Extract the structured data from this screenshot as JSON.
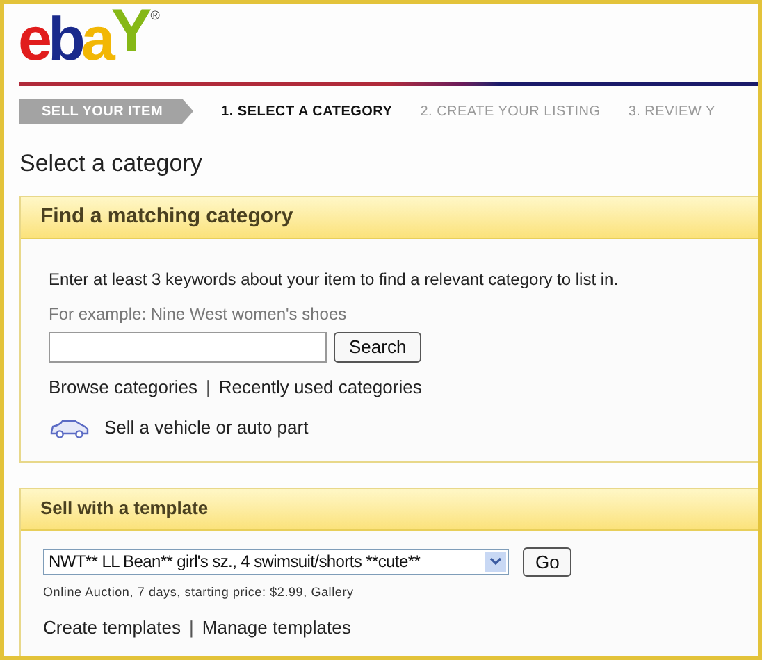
{
  "logo": {
    "letters": [
      {
        "char": "e",
        "color": "#e11d1d"
      },
      {
        "char": "b",
        "color": "#1a2a8c"
      },
      {
        "char": "a",
        "color": "#f2b705"
      },
      {
        "char": "Y",
        "color": "#86b817"
      }
    ],
    "mark": "®"
  },
  "steps": [
    {
      "label": "SELL YOUR ITEM",
      "kind": "banner",
      "selected": false
    },
    {
      "label": "1. SELECT A CATEGORY",
      "kind": "step",
      "selected": true
    },
    {
      "label": "2. CREATE YOUR LISTING",
      "kind": "step",
      "selected": false
    },
    {
      "label": "3. REVIEW Y",
      "kind": "step",
      "selected": false
    }
  ],
  "page_title": "Select a category",
  "find_panel": {
    "title": "Find a matching category",
    "intro": "Enter at least 3 keywords about your item to find a relevant category to list in.",
    "example": "For example: Nine West women's shoes",
    "search_button": "Search",
    "links": [
      "Browse categories",
      "Recently used categories"
    ],
    "link_separator": "|",
    "vehicle_link": "Sell a vehicle or auto part"
  },
  "template_panel": {
    "title": "Sell with a template",
    "template_value": "NWT** LL Bean** girl's sz., 4 swimsuit/shorts **cute**",
    "go_button": "Go",
    "details": "Online Auction, 7 days, starting price: $2.99, Gallery",
    "links": [
      "Create templates",
      "Manage templates"
    ],
    "link_separator": "|"
  }
}
